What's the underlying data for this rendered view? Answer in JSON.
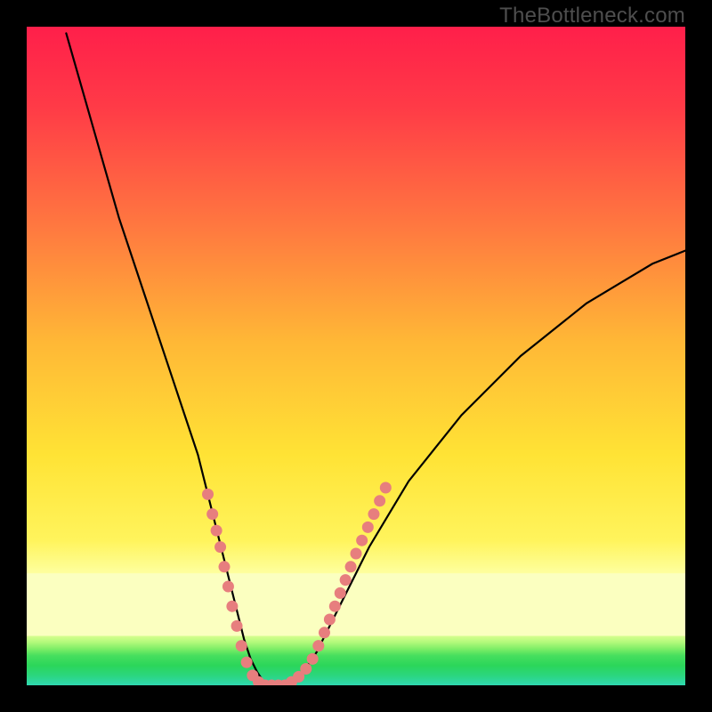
{
  "watermark": "TheBottleneck.com",
  "colors": {
    "background": "#000000",
    "curve": "#000000",
    "marker_fill": "#e77e7e",
    "marker_stroke": "#d46a6a",
    "gradient_top": "#ff1f4a",
    "gradient_mid_orange": "#ff8a3a",
    "gradient_yellow": "#ffe234",
    "gradient_pale": "#fbffb0",
    "gradient_green": "#2bd65a",
    "gradient_cyan": "#2fd8b0"
  },
  "chart_data": {
    "type": "line",
    "title": "",
    "xlabel": "",
    "ylabel": "",
    "xlim": [
      0,
      100
    ],
    "ylim": [
      0,
      100
    ],
    "series": [
      {
        "name": "bottleneck-curve",
        "x": [
          6,
          8,
          10,
          12,
          14,
          16,
          18,
          20,
          22,
          24,
          26,
          27,
          28,
          29,
          30,
          31,
          32,
          33,
          34,
          35,
          36,
          37,
          38,
          39,
          40,
          42,
          44,
          46,
          48,
          50,
          52,
          55,
          58,
          62,
          66,
          70,
          75,
          80,
          85,
          90,
          95,
          100
        ],
        "y": [
          99,
          92,
          85,
          78,
          71,
          65,
          59,
          53,
          47,
          41,
          35,
          31,
          27,
          23,
          19,
          15,
          11,
          7,
          4,
          2,
          0.5,
          0,
          0,
          0,
          0.5,
          2,
          5,
          9,
          13,
          17,
          21,
          26,
          31,
          36,
          41,
          45,
          50,
          54,
          58,
          61,
          64,
          66
        ]
      }
    ],
    "markers": [
      {
        "x": 27.5,
        "y": 29
      },
      {
        "x": 28.2,
        "y": 26
      },
      {
        "x": 28.8,
        "y": 23.5
      },
      {
        "x": 29.4,
        "y": 21
      },
      {
        "x": 30.0,
        "y": 18
      },
      {
        "x": 30.6,
        "y": 15
      },
      {
        "x": 31.2,
        "y": 12
      },
      {
        "x": 31.9,
        "y": 9
      },
      {
        "x": 32.6,
        "y": 6
      },
      {
        "x": 33.4,
        "y": 3.5
      },
      {
        "x": 34.3,
        "y": 1.5
      },
      {
        "x": 35.2,
        "y": 0.5
      },
      {
        "x": 36.2,
        "y": 0
      },
      {
        "x": 37.2,
        "y": 0
      },
      {
        "x": 38.2,
        "y": 0
      },
      {
        "x": 39.2,
        "y": 0
      },
      {
        "x": 40.2,
        "y": 0.5
      },
      {
        "x": 41.3,
        "y": 1.3
      },
      {
        "x": 42.4,
        "y": 2.5
      },
      {
        "x": 43.4,
        "y": 4
      },
      {
        "x": 44.3,
        "y": 6
      },
      {
        "x": 45.2,
        "y": 8
      },
      {
        "x": 46.0,
        "y": 10
      },
      {
        "x": 46.8,
        "y": 12
      },
      {
        "x": 47.6,
        "y": 14
      },
      {
        "x": 48.4,
        "y": 16
      },
      {
        "x": 49.2,
        "y": 18
      },
      {
        "x": 50.0,
        "y": 20
      },
      {
        "x": 50.9,
        "y": 22
      },
      {
        "x": 51.8,
        "y": 24
      },
      {
        "x": 52.7,
        "y": 26
      },
      {
        "x": 53.6,
        "y": 28
      },
      {
        "x": 54.5,
        "y": 30
      }
    ]
  }
}
